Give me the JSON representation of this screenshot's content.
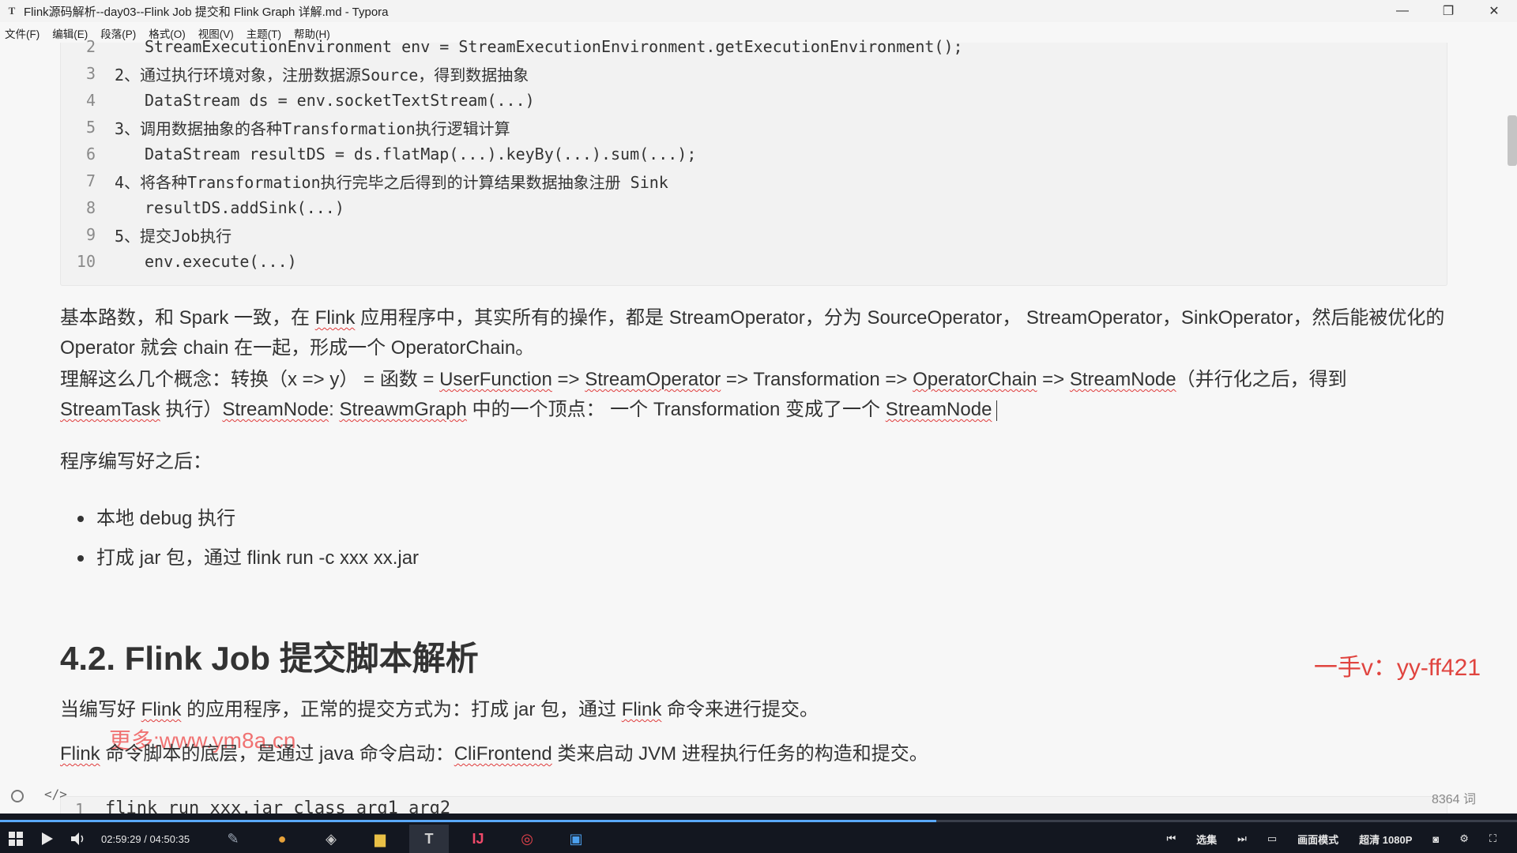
{
  "window": {
    "app_icon": "T",
    "title": "Flink源码解析--day03--Flink Job 提交和 Flink Graph 详解.md - Typora",
    "controls": {
      "minimize": "—",
      "maximize": "❐",
      "close": "✕"
    }
  },
  "menu": [
    "文件(F)",
    "编辑(E)",
    "段落(P)",
    "格式(O)",
    "视图(V)",
    "主题(T)",
    "帮助(H)"
  ],
  "code_block": {
    "lines": [
      {
        "n": "2",
        "text": "StreamExecutionEnvironment env = StreamExecutionEnvironment.getExecutionEnvironment();"
      },
      {
        "n": "3",
        "text": "2、通过执行环境对象，注册数据源Source，得到数据抽象"
      },
      {
        "n": "4",
        "text": "DataStream ds = env.socketTextStream(...)"
      },
      {
        "n": "5",
        "text": "3、调用数据抽象的各种Transformation执行逻辑计算"
      },
      {
        "n": "6",
        "text": "DataStream resultDS = ds.flatMap(...).keyBy(...).sum(...);"
      },
      {
        "n": "7",
        "text": "4、将各种Transformation执行完毕之后得到的计算结果数据抽象注册 Sink"
      },
      {
        "n": "8",
        "text": "resultDS.addSink(...)"
      },
      {
        "n": "9",
        "text": "5、提交Job执行"
      },
      {
        "n": "10",
        "text": "env.execute(...)"
      }
    ]
  },
  "paragraphs": {
    "p1": {
      "a": "基本路数，和 Spark 一致，在 ",
      "flink": "Flink",
      "b": " 应用程序中，其实所有的操作，都是 StreamOperator，分为 SourceOperator， StreamOperator，SinkOperator，然后能被优化的 Operator 就会 chain 在一起，形成一个 OperatorChain。"
    },
    "p2": {
      "a": "理解这么几个概念：转换（x => y） = 函数 = ",
      "uf": "UserFunction",
      "b": " => ",
      "so": "StreamOperator",
      "c": " => Transformation  => ",
      "oc": "OperatorChain",
      "d": " => ",
      "sn": "StreamNode",
      "e": "（并行化之后，得到 ",
      "st": "StreamTask",
      "f": " 执行）",
      "sn2": "StreamNode",
      "g": ": ",
      "sg": "StreawmGraph",
      "h": " 中的一个顶点：  一个 Transformation 变成了一个 ",
      "sn3": "StreamNode"
    },
    "p3": "程序编写好之后：",
    "bullets": [
      "本地 debug 执行",
      "打成 jar 包，通过 flink run -c xxx xx.jar"
    ],
    "heading": "4.2. Flink Job 提交脚本解析",
    "p4": {
      "a": "当编写好 ",
      "flink": "Flink",
      "b": " 的应用程序，正常的提交方式为：打成 jar 包，通过 ",
      "flink2": "Flink",
      "c": " 命令来进行提交。"
    },
    "p5": {
      "flink": "Flink",
      "a": " 命令脚本的底层，是通过 java 命令启动：",
      "cf": "CliFrontend",
      "b": " 类来启动 JVM 进程执行任务的构造和提交。"
    },
    "mini_code": {
      "n": "1",
      "text": "flink run xxx.jar class arg1 arg2"
    }
  },
  "watermarks": {
    "contact": "一手v：yy-ff421",
    "site": "更多:www.ym8a.cn"
  },
  "statusbar": {
    "source_toggle": "</>",
    "word_count": "8364 词"
  },
  "player": {
    "timecode": "02:59:29 / 04:50:35",
    "progress": 0.617,
    "taskbar_icons": [
      {
        "name": "paint-icon",
        "glyph": "✎",
        "color": "#9aa4b2"
      },
      {
        "name": "chrome-icon",
        "glyph": "●",
        "color": "#e7a23a"
      },
      {
        "name": "unity-icon",
        "glyph": "◈",
        "color": "#c8c8c8"
      },
      {
        "name": "folder-icon",
        "glyph": "▆",
        "color": "#e9c046"
      },
      {
        "name": "typora-icon",
        "glyph": "T",
        "color": "#d0d0d0"
      },
      {
        "name": "intellij-icon",
        "glyph": "IJ",
        "color": "#f04a6a"
      },
      {
        "name": "netease-music-icon",
        "glyph": "◎",
        "color": "#e8434c"
      },
      {
        "name": "media-player-icon",
        "glyph": "▣",
        "color": "#4ca0ee"
      }
    ],
    "right": {
      "episodes": "选集",
      "picture_mode": "画面模式",
      "quality": "超清 1080P"
    }
  }
}
